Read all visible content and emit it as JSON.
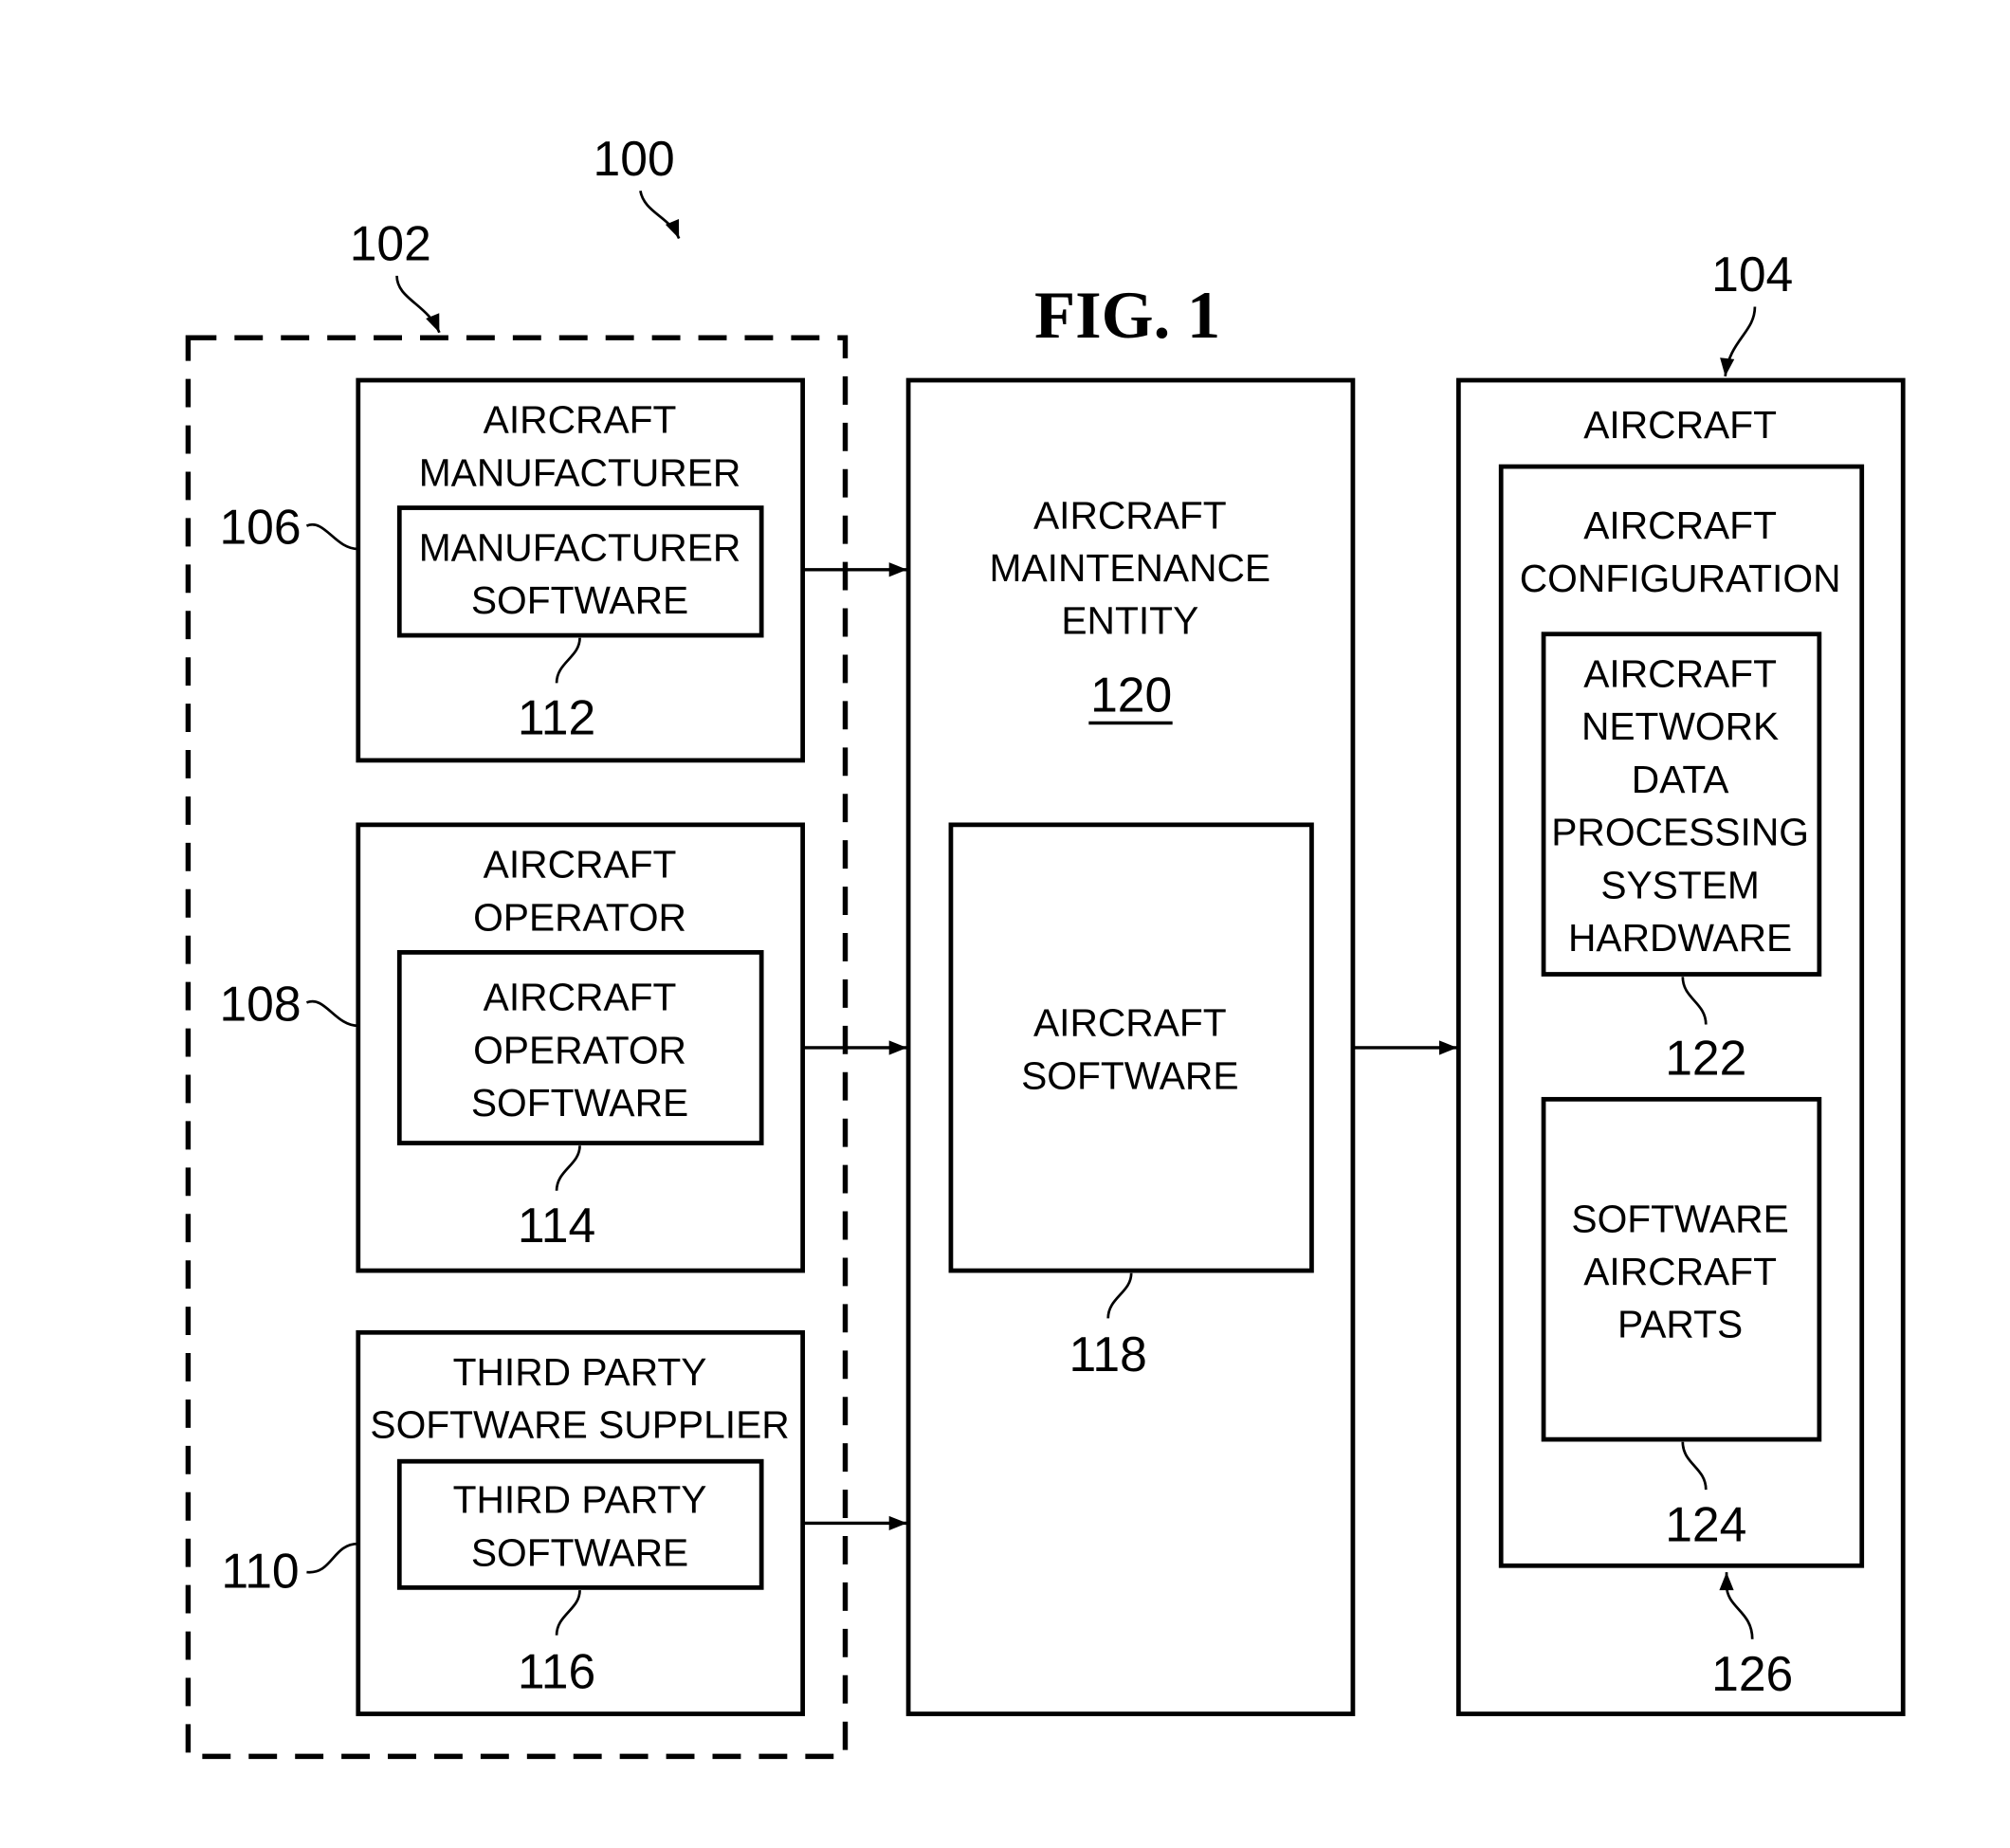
{
  "figure": {
    "title": "FIG. 1",
    "refs": {
      "system": "100",
      "sources": "102",
      "aircraft": "104",
      "configuration": "126"
    }
  },
  "sources": [
    {
      "ref": "106",
      "title": [
        "AIRCRAFT",
        "MANUFACTURER"
      ],
      "inner_ref": "112",
      "inner": [
        "MANUFACTURER",
        "SOFTWARE"
      ]
    },
    {
      "ref": "108",
      "title": [
        "AIRCRAFT",
        "OPERATOR"
      ],
      "inner_ref": "114",
      "inner": [
        "AIRCRAFT",
        "OPERATOR",
        "SOFTWARE"
      ]
    },
    {
      "ref": "110",
      "title": [
        "THIRD PARTY",
        "SOFTWARE SUPPLIER"
      ],
      "inner_ref": "116",
      "inner": [
        "THIRD PARTY",
        "SOFTWARE"
      ]
    }
  ],
  "maintenance": {
    "title": [
      "AIRCRAFT",
      "MAINTENANCE",
      "ENTITY"
    ],
    "ref": "120",
    "software": [
      "AIRCRAFT",
      "SOFTWARE"
    ],
    "software_ref": "118"
  },
  "aircraft": {
    "title": "AIRCRAFT",
    "config_title": [
      "AIRCRAFT",
      "CONFIGURATION"
    ],
    "hardware": [
      "AIRCRAFT",
      "NETWORK",
      "DATA",
      "PROCESSING",
      "SYSTEM",
      "HARDWARE"
    ],
    "hardware_ref": "122",
    "parts": [
      "SOFTWARE",
      "AIRCRAFT",
      "PARTS"
    ],
    "parts_ref": "124"
  }
}
